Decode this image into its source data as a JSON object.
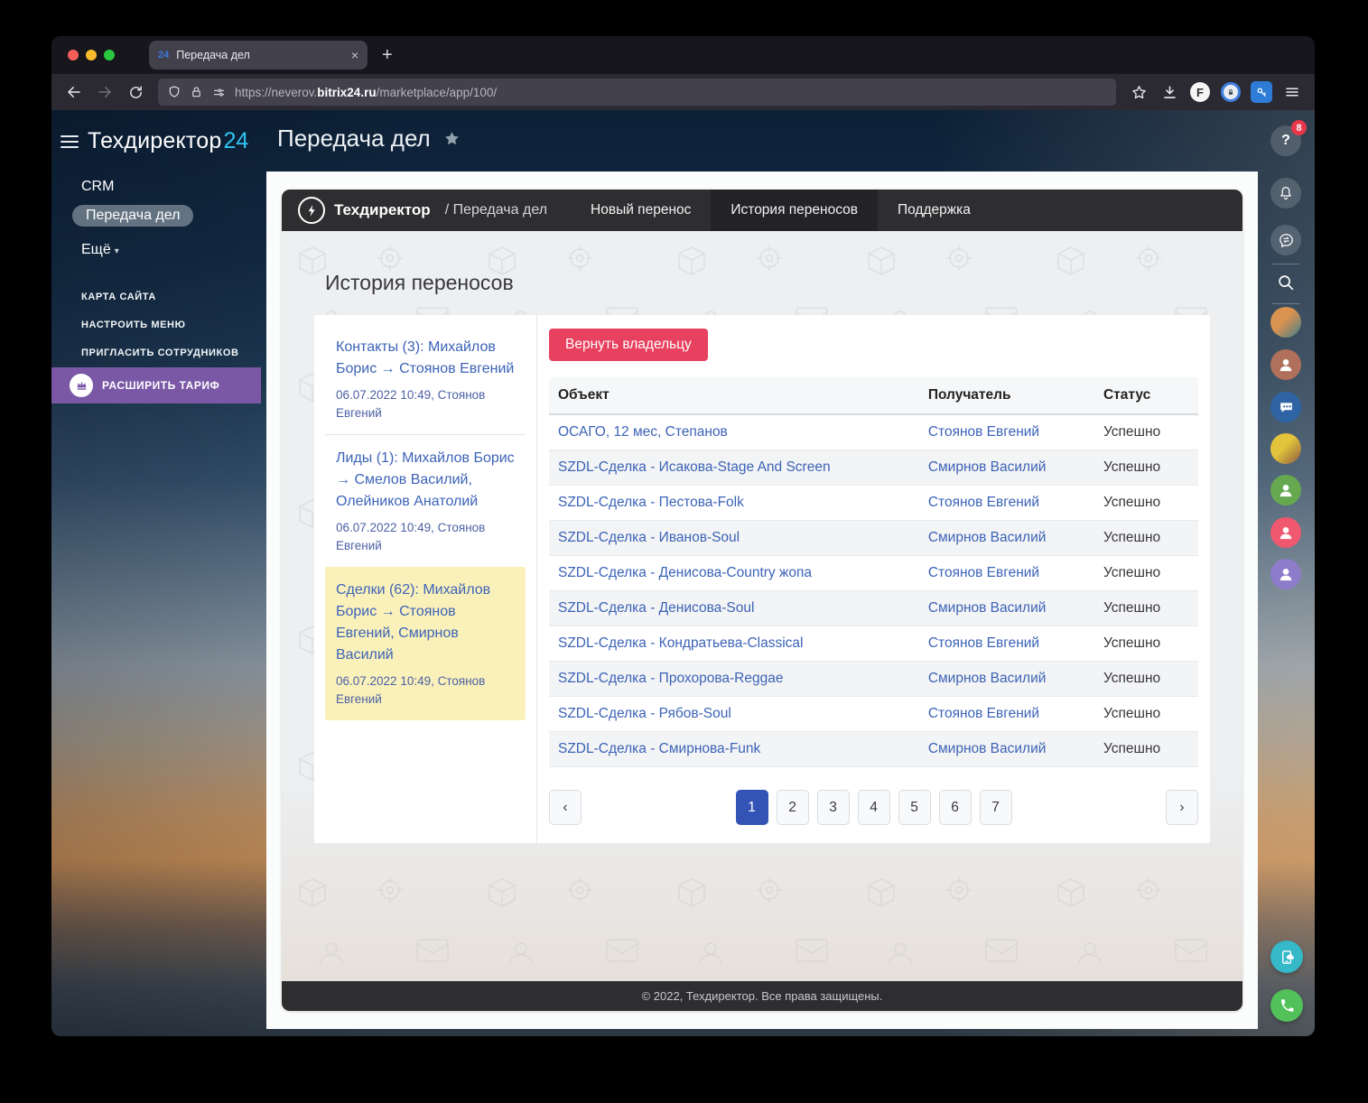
{
  "browser": {
    "tab": {
      "favicon_label": "24",
      "title": "Передача дел",
      "close_glyph": "×",
      "newtab_glyph": "+"
    },
    "url": {
      "prefix": "https://neverov.",
      "domain": "bitrix24.ru",
      "path": "/marketplace/app/100/"
    },
    "toolbar": {
      "f_extension_label": "F"
    }
  },
  "sidebar": {
    "logo": {
      "text": "Техдиректор",
      "accent": "24"
    },
    "items": [
      {
        "label": "CRM",
        "active": false
      },
      {
        "label": "Передача дел",
        "active": true
      },
      {
        "label": "Ещё",
        "caret": "▾",
        "active": false
      }
    ],
    "links": [
      "КАРТА САЙТА",
      "НАСТРОИТЬ МЕНЮ",
      "ПРИГЛАСИТЬ СОТРУДНИКОВ"
    ],
    "upgrade_label": "РАСШИРИТЬ ТАРИФ"
  },
  "header": {
    "title": "Передача дел"
  },
  "app": {
    "navbar": {
      "brand": "Техдиректор",
      "breadcrumb": "/ Передача дел",
      "items": [
        {
          "label": "Новый перенос",
          "active": false
        },
        {
          "label": "История переносов",
          "active": true
        },
        {
          "label": "Поддержка",
          "active": false
        }
      ]
    },
    "heading": "История переносов",
    "transfers": [
      {
        "title": "Контакты (3): Михайлов Борис → Стоянов Евгений",
        "meta": "06.07.2022 10:49, Стоянов Евгений",
        "selected": false
      },
      {
        "title": "Лиды (1): Михайлов Борис → Смелов Василий, Олейников Анатолий",
        "meta": "06.07.2022 10:49, Стоянов Евгений",
        "selected": false
      },
      {
        "title": "Сделки (62): Михайлов Борис → Стоянов Евгений, Смирнов Василий",
        "meta": "06.07.2022 10:49, Стоянов Евгений",
        "selected": true
      }
    ],
    "return_button_label": "Вернуть владельцу",
    "table": {
      "columns": [
        "Объект",
        "Получатель",
        "Статус"
      ],
      "rows": [
        {
          "object": "ОСАГО, 12 мес, Степанов",
          "recipient": "Стоянов Евгений",
          "status": "Успешно"
        },
        {
          "object": "SZDL-Сделка - Исакова-Stage And Screen",
          "recipient": "Смирнов Василий",
          "status": "Успешно"
        },
        {
          "object": "SZDL-Сделка - Пестова-Folk",
          "recipient": "Стоянов Евгений",
          "status": "Успешно"
        },
        {
          "object": "SZDL-Сделка - Иванов-Soul",
          "recipient": "Смирнов Василий",
          "status": "Успешно"
        },
        {
          "object": "SZDL-Сделка - Денисова-Country жопа",
          "recipient": "Стоянов Евгений",
          "status": "Успешно"
        },
        {
          "object": "SZDL-Сделка - Денисова-Soul",
          "recipient": "Смирнов Василий",
          "status": "Успешно"
        },
        {
          "object": "SZDL-Сделка - Кондратьева-Classical",
          "recipient": "Стоянов Евгений",
          "status": "Успешно"
        },
        {
          "object": "SZDL-Сделка - Прохорова-Reggae",
          "recipient": "Смирнов Василий",
          "status": "Успешно"
        },
        {
          "object": "SZDL-Сделка - Рябов-Soul",
          "recipient": "Стоянов Евгений",
          "status": "Успешно"
        },
        {
          "object": "SZDL-Сделка - Смирнова-Funk",
          "recipient": "Смирнов Василий",
          "status": "Успешно"
        }
      ]
    },
    "pagination": {
      "prev_glyph": "‹",
      "next_glyph": "›",
      "pages": [
        "1",
        "2",
        "3",
        "4",
        "5",
        "6",
        "7"
      ],
      "active_page": "1"
    },
    "footer_text": "© 2022, Техдиректор. Все права защищены."
  },
  "right_rail": {
    "help_glyph": "?",
    "help_badge": "8",
    "avatars": [
      {
        "kind": "photo",
        "color1": "#d9924f",
        "color2": "#3f7f8f"
      },
      {
        "kind": "person",
        "color1": "#b0705c",
        "color2": "#b0705c"
      },
      {
        "kind": "chat",
        "color1": "#2e63a4",
        "color2": "#2e63a4"
      },
      {
        "kind": "photo",
        "color1": "#e3c23c",
        "color2": "#8a5a3f"
      },
      {
        "kind": "person",
        "color1": "#66a84f",
        "color2": "#66a84f"
      },
      {
        "kind": "person",
        "color1": "#f0586f",
        "color2": "#f0586f"
      },
      {
        "kind": "person",
        "color1": "#8d7cc9",
        "color2": "#8d7cc9"
      }
    ],
    "float_buttons": [
      {
        "name": "mobile-app-button",
        "color": "#35b8c8"
      },
      {
        "name": "voice-call-button",
        "color": "#52c15a"
      }
    ]
  },
  "colors": {
    "link": "#3c63b7",
    "danger": "#e8415f",
    "highlight": "#faf1ba",
    "active_page": "#3353b5",
    "logo_accent": "#31c4f3",
    "upgrade": "#7a58a6",
    "badge": "#e8374a"
  }
}
